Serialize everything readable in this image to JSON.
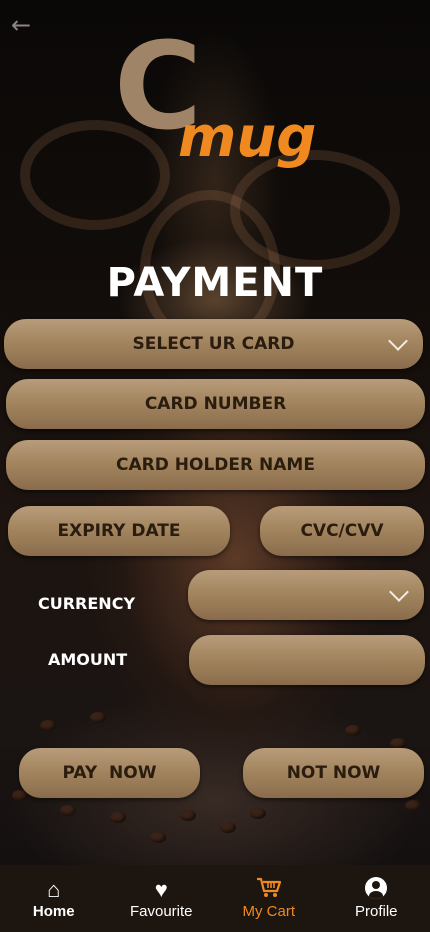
{
  "app": {
    "logo_letter": "C",
    "logo_word": "mug"
  },
  "page": {
    "title": "PAYMENT"
  },
  "form": {
    "select_card": "SELECT UR CARD",
    "card_number": "CARD NUMBER",
    "card_holder_name": "CARD HOLDER NAME",
    "expiry_date": "EXPIRY DATE",
    "cvc_cvv": "CVC/CVV",
    "currency_label": "CURRENCY",
    "amount_label": "AMOUNT",
    "pay_now": "PAY  NOW",
    "not_now": "NOT NOW"
  },
  "nav": {
    "items": [
      {
        "label": "Home",
        "icon": "home-icon"
      },
      {
        "label": "Favourite",
        "icon": "heart-icon"
      },
      {
        "label": "My Cart",
        "icon": "cart-icon"
      },
      {
        "label": "Profile",
        "icon": "profile-icon"
      }
    ],
    "active": "My Cart"
  },
  "colors": {
    "accent": "#f08a20",
    "logo_brown": "#a08468",
    "field_brown": "#a3865f",
    "nav_bg": "#1d150f"
  }
}
